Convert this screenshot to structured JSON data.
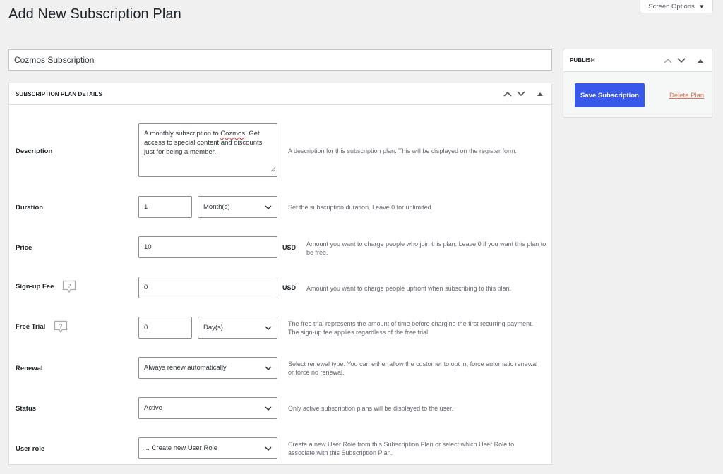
{
  "page": {
    "title": "Add New Subscription Plan",
    "screen_options_label": "Screen Options"
  },
  "title_field": {
    "value": "Cozmos Subscription"
  },
  "details_box": {
    "title": "Subscription Plan Details",
    "rows": {
      "description": {
        "label": "Description",
        "value_prefix": "A monthly subscription to ",
        "value_misspelled": "Cozmos",
        "value_suffix": ". Get access to special content and discounts just for being a member.",
        "help": "A description for this subscription plan. This will be displayed on the register form."
      },
      "duration": {
        "label": "Duration",
        "value": "1",
        "unit": "Month(s)",
        "help": "Set the subscription duration. Leave 0 for unlimited."
      },
      "price": {
        "label": "Price",
        "value": "10",
        "currency": "USD",
        "help": "Amount you want to charge people who join this plan. Leave 0 if you want this plan to be free."
      },
      "signup_fee": {
        "label": "Sign-up Fee",
        "value": "0",
        "currency": "USD",
        "help": "Amount you want to charge people upfront when subscribing to this plan."
      },
      "free_trial": {
        "label": "Free Trial",
        "value": "0",
        "unit": "Day(s)",
        "help": "The free trial represents the amount of time before charging the first recurring payment. The sign-up fee applies regardless of the free trial."
      },
      "renewal": {
        "label": "Renewal",
        "value": "Always renew automatically",
        "help": "Select renewal type. You can either allow the customer to opt in, force automatic renewal or force no renewal."
      },
      "status": {
        "label": "Status",
        "value": "Active",
        "help": "Only active subscription plans will be displayed to the user."
      },
      "user_role": {
        "label": "User role",
        "value": "... Create new User Role",
        "help": "Create a new User Role from this Subscription Plan or select which User Role to associate with this Subscription Plan."
      }
    }
  },
  "publish_box": {
    "title": "Publish",
    "save_label": "Save Subscription",
    "delete_label": "Delete Plan"
  },
  "colors": {
    "primary_button": "#3858e9",
    "delete_link": "#e26f56",
    "background": "#f0f0f1"
  }
}
